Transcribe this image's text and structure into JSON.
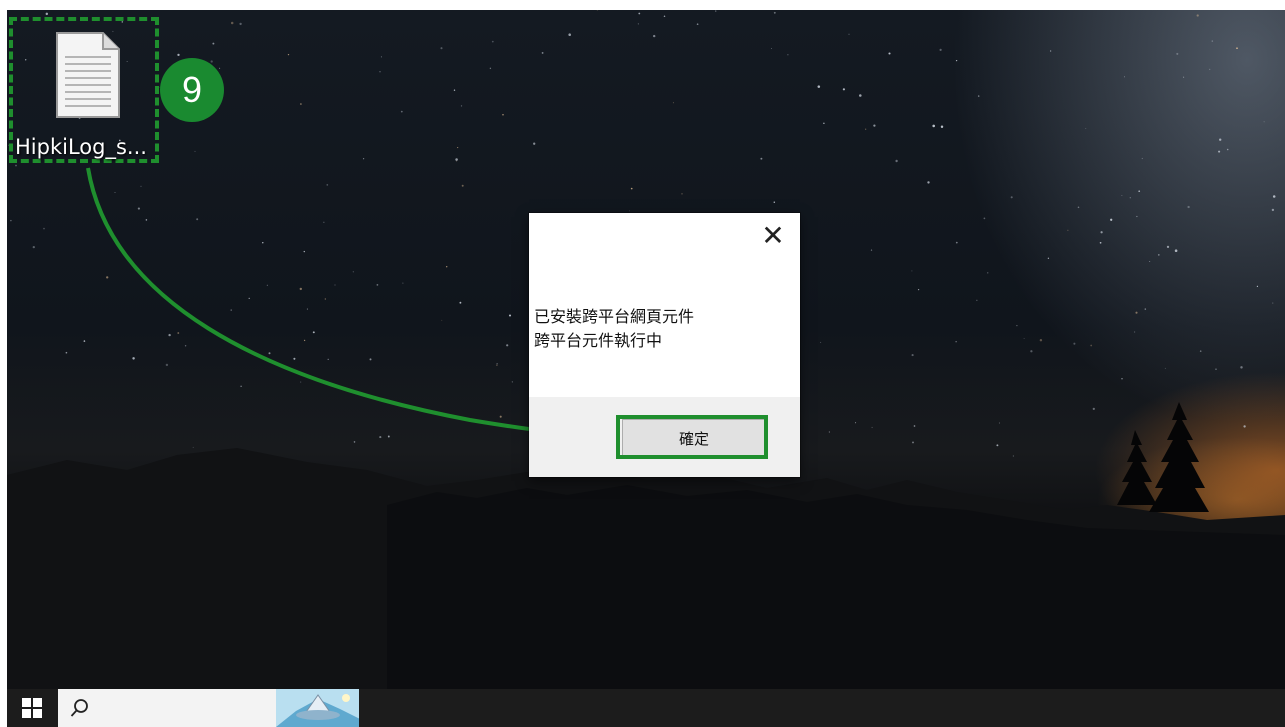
{
  "desktop": {
    "file_icon": {
      "label": "HipkiLog_s...",
      "icon": "text-document-icon"
    },
    "step_badge": "9",
    "annotation_color": "#1f8f2e"
  },
  "dialog": {
    "close_glyph": "✕",
    "message_line1": "已安裝跨平台網頁元件",
    "message_line2": "跨平台元件執行中",
    "ok_label": "確定"
  },
  "taskbar": {
    "start_icon": "windows-logo-icon",
    "search_icon": "search-icon"
  }
}
